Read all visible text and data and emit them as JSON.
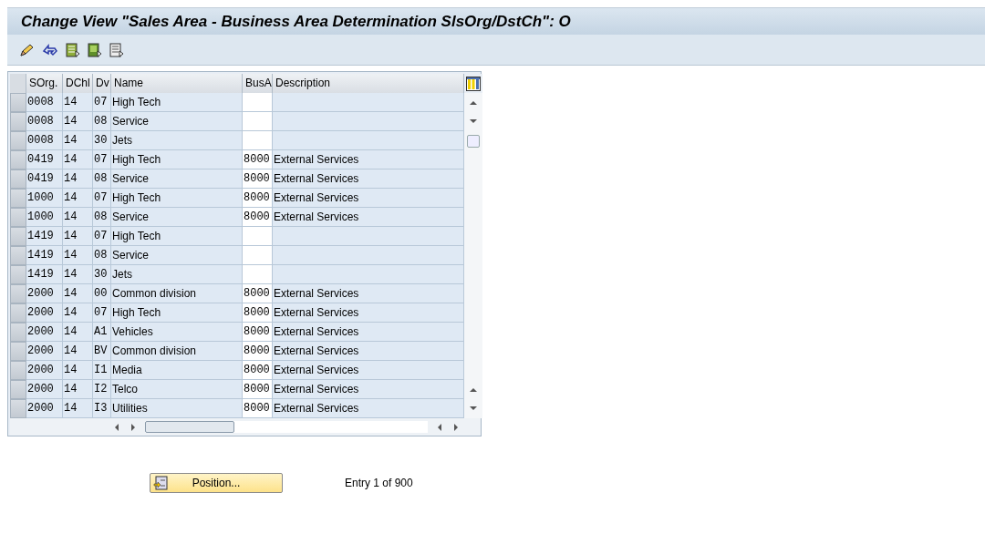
{
  "window": {
    "title": "Change View \"Sales Area - Business Area Determination SlsOrg/DstCh\": O"
  },
  "table": {
    "columns": [
      "SOrg.",
      "DChl",
      "Dv",
      "Name",
      "BusA",
      "Description"
    ],
    "rows": [
      {
        "sorg": "0008",
        "dchl": "14",
        "dv": "07",
        "name": "High Tech"
      },
      {
        "sorg": "0008",
        "dchl": "14",
        "dv": "08",
        "name": "Service"
      },
      {
        "sorg": "0008",
        "dchl": "14",
        "dv": "30",
        "name": "Jets"
      },
      {
        "sorg": "0419",
        "dchl": "14",
        "dv": "07",
        "name": "High Tech",
        "busa": "8000",
        "description": "External Services"
      },
      {
        "sorg": "0419",
        "dchl": "14",
        "dv": "08",
        "name": "Service",
        "busa": "8000",
        "description": "External Services"
      },
      {
        "sorg": "1000",
        "dchl": "14",
        "dv": "07",
        "name": "High Tech",
        "busa": "8000",
        "description": "External Services"
      },
      {
        "sorg": "1000",
        "dchl": "14",
        "dv": "08",
        "name": "Service",
        "busa": "8000",
        "description": "External Services"
      },
      {
        "sorg": "1419",
        "dchl": "14",
        "dv": "07",
        "name": "High Tech"
      },
      {
        "sorg": "1419",
        "dchl": "14",
        "dv": "08",
        "name": "Service"
      },
      {
        "sorg": "1419",
        "dchl": "14",
        "dv": "30",
        "name": "Jets"
      },
      {
        "sorg": "2000",
        "dchl": "14",
        "dv": "00",
        "name": "Common division",
        "busa": "8000",
        "description": "External Services"
      },
      {
        "sorg": "2000",
        "dchl": "14",
        "dv": "07",
        "name": "High Tech",
        "busa": "8000",
        "description": "External Services"
      },
      {
        "sorg": "2000",
        "dchl": "14",
        "dv": "A1",
        "name": "Vehicles",
        "busa": "8000",
        "description": "External Services"
      },
      {
        "sorg": "2000",
        "dchl": "14",
        "dv": "BV",
        "name": "Common division",
        "busa": "8000",
        "description": "External Services"
      },
      {
        "sorg": "2000",
        "dchl": "14",
        "dv": "I1",
        "name": "Media",
        "busa": "8000",
        "description": "External Services"
      },
      {
        "sorg": "2000",
        "dchl": "14",
        "dv": "I2",
        "name": "Telco",
        "busa": "8000",
        "description": "External Services"
      },
      {
        "sorg": "2000",
        "dchl": "14",
        "dv": "I3",
        "name": "Utilities",
        "busa": "8000",
        "description": "External Services"
      }
    ]
  },
  "position_button": "Position...",
  "entry_info": "Entry 1 of 900"
}
